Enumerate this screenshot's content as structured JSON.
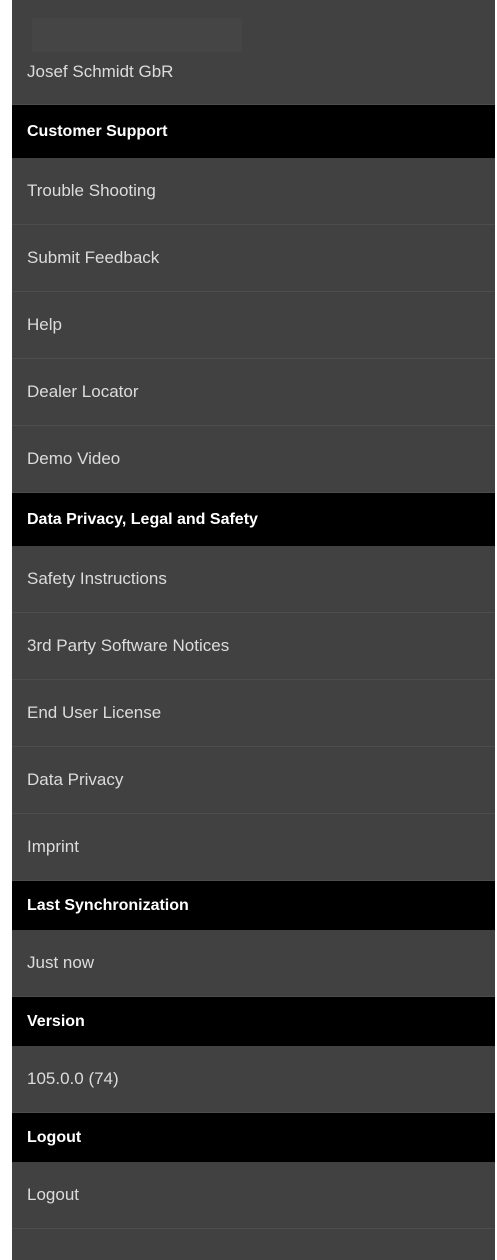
{
  "account": {
    "company_name": "Josef Schmidt GbR"
  },
  "sections": {
    "customer_support": {
      "header": "Customer Support",
      "items": [
        "Trouble Shooting",
        "Submit Feedback",
        "Help",
        "Dealer Locator",
        "Demo Video"
      ]
    },
    "legal": {
      "header": "Data Privacy, Legal and Safety",
      "items": [
        "Safety Instructions",
        "3rd Party Software Notices",
        "End User License",
        "Data Privacy",
        "Imprint"
      ]
    },
    "sync": {
      "header": "Last Synchronization",
      "value": "Just now"
    },
    "version": {
      "header": "Version",
      "value": "105.0.0 (74)"
    },
    "logout": {
      "header": "Logout",
      "item": "Logout"
    }
  },
  "colors": {
    "panel_background": "#414141",
    "header_background": "#000000",
    "text": "#dcdcdc",
    "header_text": "#ffffff"
  }
}
